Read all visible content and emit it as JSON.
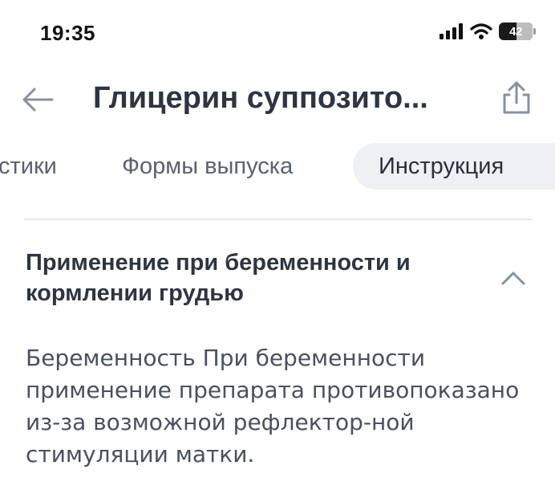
{
  "status_bar": {
    "time": "19:35",
    "battery": "42",
    "icons": [
      "signal-icon",
      "wifi-icon",
      "battery-icon"
    ]
  },
  "header": {
    "title": "Глицерин суппозито...",
    "back_icon": "arrow-left-icon",
    "share_icon": "share-icon"
  },
  "tabs": [
    {
      "label": "стики",
      "active": false
    },
    {
      "label": "Формы выпуска",
      "active": false
    },
    {
      "label": "Инструкция",
      "active": true
    }
  ],
  "section": {
    "title": "Применение при беременности и кормлении грудью",
    "expanded": true,
    "chevron_icon": "chevron-up-icon",
    "body": "Беременность При беременности применение препарата противопоказано из-за возможной рефлектор-ной стимуляции матки."
  },
  "colors": {
    "text_primary": "#2e3440",
    "text_secondary": "#5a6170",
    "active_tab_bg": "#eef0f4",
    "divider": "#e6e8ec",
    "icon": "#8a909c"
  }
}
